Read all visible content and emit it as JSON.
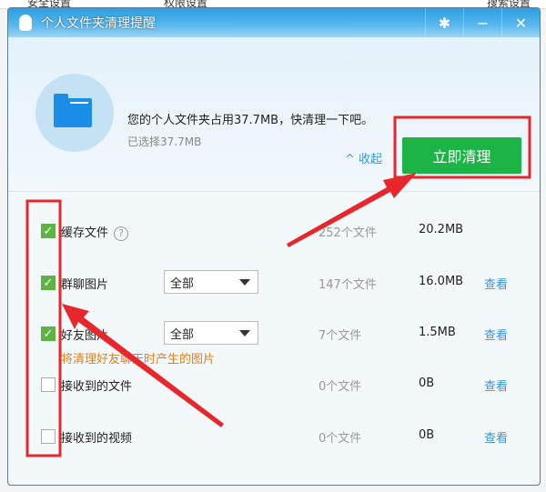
{
  "background": {
    "items": [
      "安全设置",
      "权限设置",
      "搜索设置"
    ]
  },
  "window": {
    "title": "个人文件夹清理提醒",
    "settings_icon": "gear-icon",
    "minimize_icon": "minimize-icon",
    "close_icon": "close-icon"
  },
  "header": {
    "message": "您的个人文件夹占用37.7MB，快清理一下吧。",
    "selected": "已选择37.7MB",
    "collapse": "^ 收起",
    "clean_button": "立即清理"
  },
  "items": [
    {
      "label": "缓存文件",
      "checked": true,
      "count": "252个文件",
      "size": "20.2MB"
    },
    {
      "label": "群聊图片",
      "checked": true,
      "filter": "全部",
      "count": "147个文件",
      "size": "16.0MB",
      "view": "查看"
    },
    {
      "label": "好友图片",
      "checked": true,
      "filter": "全部",
      "count": "7个文件",
      "size": "1.5MB",
      "view": "查看",
      "hint": "将清理好友聊天时产生的图片"
    },
    {
      "label": "接收到的文件",
      "checked": false,
      "count": "0个文件",
      "size": "0B",
      "view": "查看"
    },
    {
      "label": "接收到的视频",
      "checked": false,
      "count": "0个文件",
      "size": "0B",
      "view": "查看"
    }
  ],
  "colors": {
    "accent": "#1cb446",
    "link": "#3b95d3",
    "annotation": "#e8272c"
  }
}
